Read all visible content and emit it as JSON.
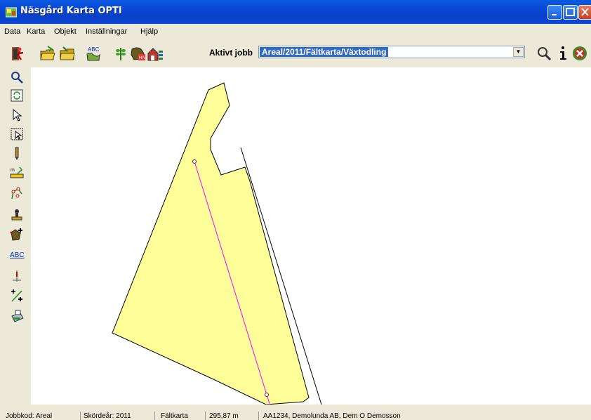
{
  "window": {
    "title": "Näsgård Karta OPTI"
  },
  "menu": {
    "items": [
      "Data",
      "Karta",
      "Objekt",
      "Inställningar",
      "Hjälp"
    ]
  },
  "toolbar": {
    "jobb_label": "Aktivt jobb",
    "jobb_value": "Areal/2011/Fältkarta/Växtodling",
    "icons": [
      "exit-icon",
      "open-folder-icon",
      "folder-icon",
      "abc-text-icon",
      "crop-icon",
      "field-ha-icon",
      "farm-icon",
      "search-icon",
      "info-icon",
      "close-icon"
    ]
  },
  "left_tools": [
    "zoom-icon",
    "refresh-icon",
    "select-arrow-icon",
    "select-area-icon",
    "pencil-icon",
    "measure-icon",
    "edit-points-icon",
    "stamp-icon",
    "add-field-icon",
    "abc-label-icon",
    "marker-icon",
    "split-icon",
    "print-icon"
  ],
  "left_tools_text": {
    "abc": "ABC"
  },
  "status": {
    "jobbkod": "Jobbkod: Areal",
    "skordear": "Skördeår: 2011",
    "karttyp": "Fältkarta",
    "distance": "295,87 m",
    "owner": "AA1234, Demolunda AB, Dem O Demosson"
  },
  "colors": {
    "field_fill": "#ffff99",
    "line": "#ff00ff",
    "title_bar": "#0a46d6"
  }
}
